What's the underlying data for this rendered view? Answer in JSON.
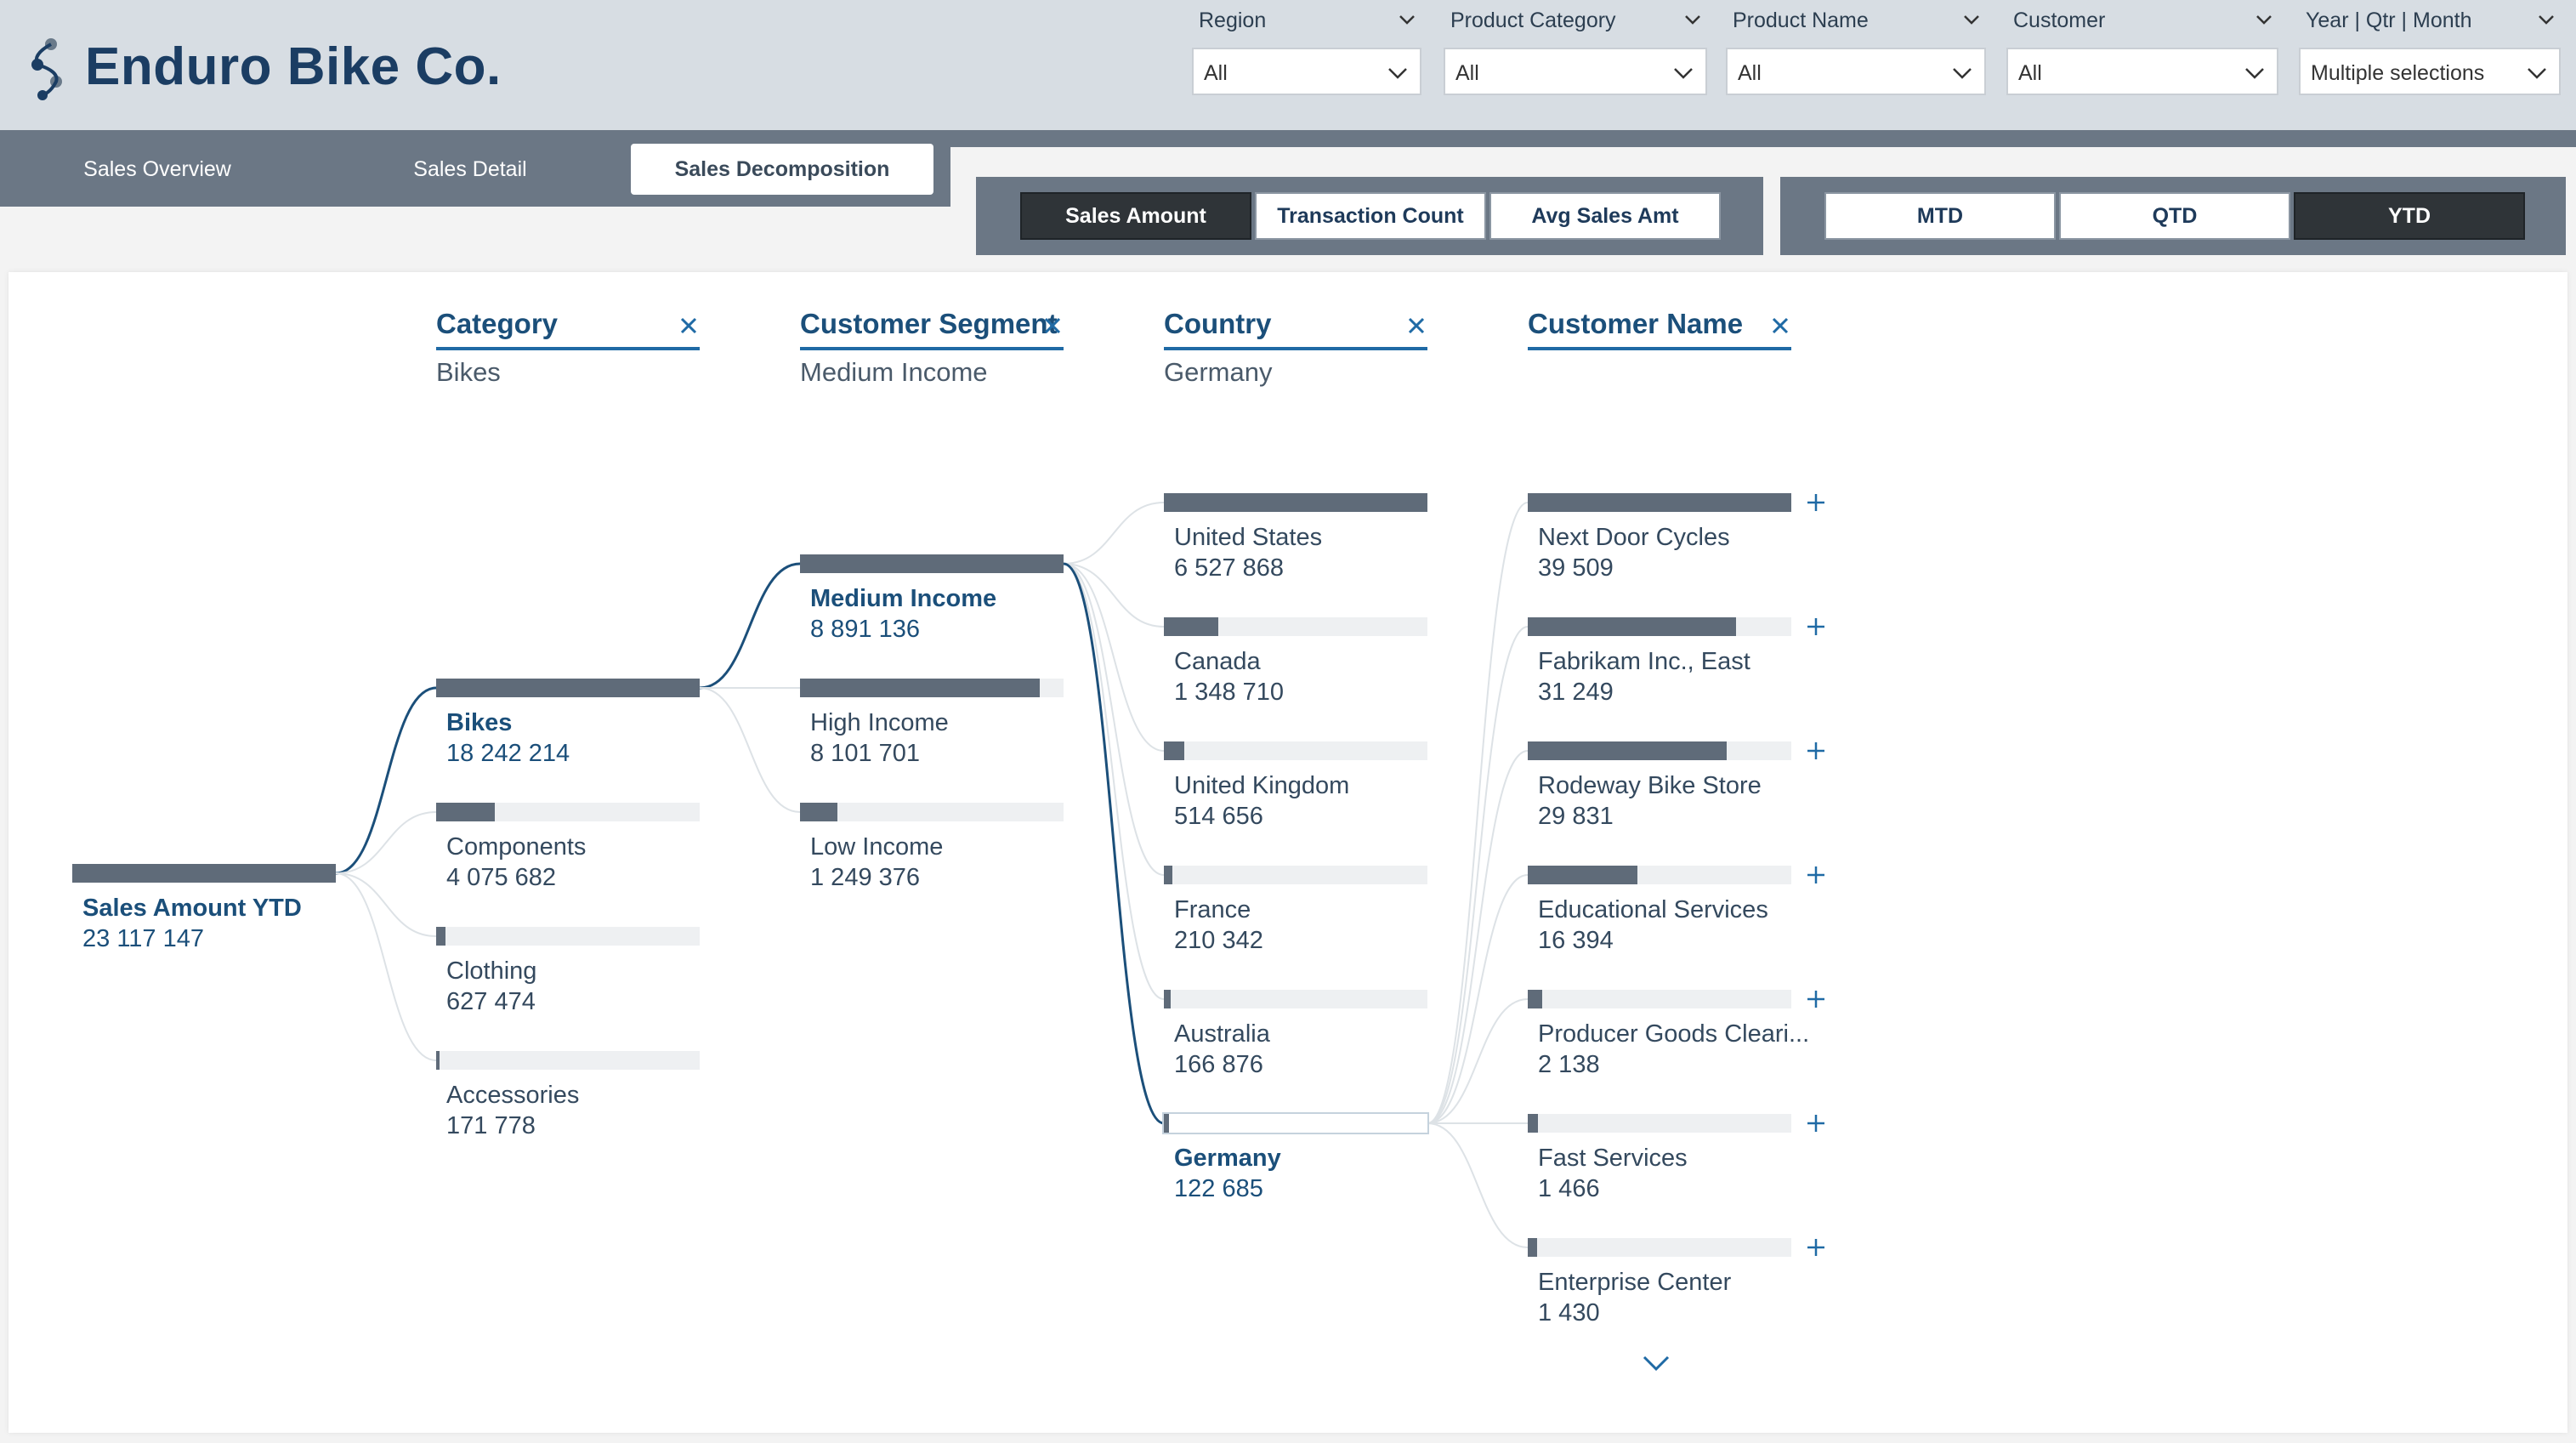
{
  "app": {
    "brand": "Enduro Bike Co."
  },
  "filters": [
    {
      "label": "Region",
      "value": "All"
    },
    {
      "label": "Product Category",
      "value": "All"
    },
    {
      "label": "Product Name",
      "value": "All"
    },
    {
      "label": "Customer",
      "value": "All"
    },
    {
      "label": "Year | Qtr | Month",
      "value": "Multiple selections"
    }
  ],
  "tabs": [
    {
      "label": "Sales Overview",
      "active": false
    },
    {
      "label": "Sales Detail",
      "active": false
    },
    {
      "label": "Sales Decomposition",
      "active": true
    }
  ],
  "measures": [
    {
      "label": "Sales Amount",
      "selected": true
    },
    {
      "label": "Transaction Count",
      "selected": false
    },
    {
      "label": "Avg Sales Amt",
      "selected": false
    }
  ],
  "periods": [
    {
      "label": "MTD",
      "selected": false
    },
    {
      "label": "QTD",
      "selected": false
    },
    {
      "label": "YTD",
      "selected": true
    }
  ],
  "colors": {
    "accent": "#1f6aa5",
    "bar": "#5f6b79",
    "bar_bg": "#eef0f2",
    "link_active": "#1b4f7a",
    "header_bg": "#d7dde3",
    "tab_bg": "#6b7785"
  },
  "chart_data": {
    "type": "decomposition-tree",
    "root": {
      "label": "Sales Amount YTD",
      "value": 23117147,
      "display": "23 117 147"
    },
    "levels": [
      {
        "title": "Category",
        "selected": "Bikes",
        "nodes": [
          {
            "label": "Bikes",
            "value": 18242214,
            "display": "18 242 214"
          },
          {
            "label": "Components",
            "value": 4075682,
            "display": "4 075 682"
          },
          {
            "label": "Clothing",
            "value": 627474,
            "display": "627 474"
          },
          {
            "label": "Accessories",
            "value": 171778,
            "display": "171 778"
          }
        ]
      },
      {
        "title": "Customer Segment",
        "selected": "Medium Income",
        "nodes": [
          {
            "label": "Medium Income",
            "value": 8891136,
            "display": "8 891 136"
          },
          {
            "label": "High Income",
            "value": 8101701,
            "display": "8 101 701"
          },
          {
            "label": "Low Income",
            "value": 1249376,
            "display": "1 249 376"
          }
        ]
      },
      {
        "title": "Country",
        "selected": "Germany",
        "nodes": [
          {
            "label": "United States",
            "value": 6527868,
            "display": "6 527 868"
          },
          {
            "label": "Canada",
            "value": 1348710,
            "display": "1 348 710"
          },
          {
            "label": "United Kingdom",
            "value": 514656,
            "display": "514 656"
          },
          {
            "label": "France",
            "value": 210342,
            "display": "210 342"
          },
          {
            "label": "Australia",
            "value": 166876,
            "display": "166 876"
          },
          {
            "label": "Germany",
            "value": 122685,
            "display": "122 685"
          }
        ]
      },
      {
        "title": "Customer Name",
        "selected": "",
        "nodes": [
          {
            "label": "Next Door Cycles",
            "value": 39509,
            "display": "39 509"
          },
          {
            "label": "Fabrikam Inc., East",
            "value": 31249,
            "display": "31 249"
          },
          {
            "label": "Rodeway Bike Store",
            "value": 29831,
            "display": "29 831"
          },
          {
            "label": "Educational Services",
            "value": 16394,
            "display": "16 394"
          },
          {
            "label": "Producer Goods Cleari...",
            "value": 2138,
            "display": "2 138"
          },
          {
            "label": "Fast Services",
            "value": 1466,
            "display": "1 466"
          },
          {
            "label": "Enterprise Center",
            "value": 1430,
            "display": "1 430"
          }
        ]
      }
    ]
  }
}
